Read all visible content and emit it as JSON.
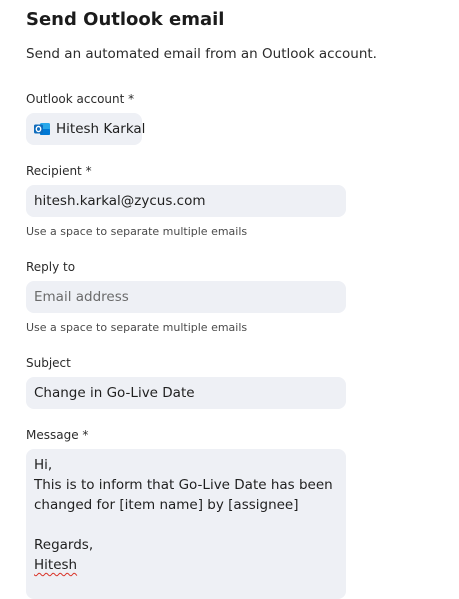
{
  "header": {
    "title": "Send Outlook email",
    "description": "Send an automated email from an Outlook account."
  },
  "account": {
    "label": "Outlook account *",
    "name": "Hitesh Karkal",
    "icon": "outlook-icon"
  },
  "recipient": {
    "label": "Recipient *",
    "value": "hitesh.karkal@zycus.com",
    "helper": "Use a space to separate multiple emails"
  },
  "reply_to": {
    "label": "Reply to",
    "value": "",
    "placeholder": "Email address",
    "helper": "Use a space to separate multiple emails"
  },
  "subject": {
    "label": "Subject",
    "value": "Change in Go-Live Date"
  },
  "message": {
    "label": "Message *",
    "lines": [
      "Hi,",
      "This is to inform that Go-Live Date has been",
      "changed for [item name] by [assignee]",
      "",
      "Regards,",
      "Hitesh"
    ]
  },
  "colors": {
    "field_background": "#eef0f5",
    "outlook_blue": "#0f6cbd"
  }
}
